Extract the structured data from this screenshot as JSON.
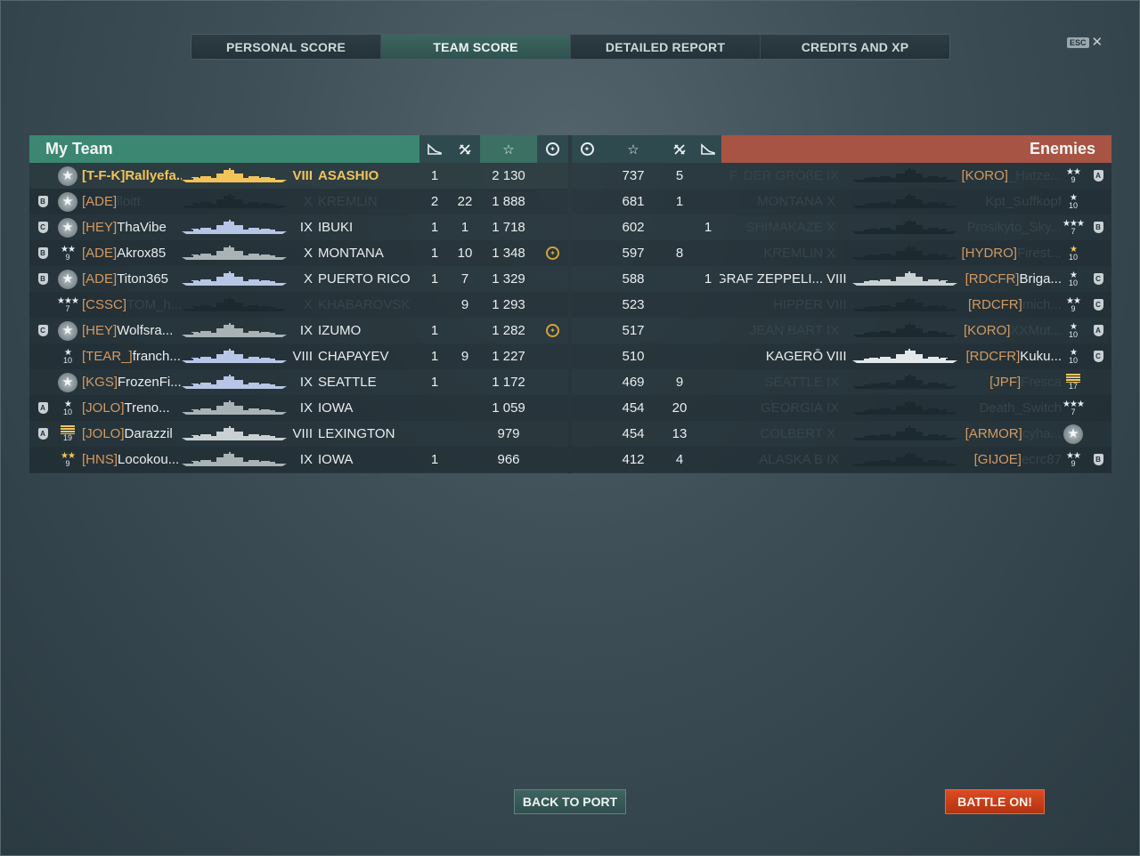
{
  "tabs": [
    {
      "label": "PERSONAL SCORE",
      "active": false
    },
    {
      "label": "TEAM SCORE",
      "active": true
    },
    {
      "label": "DETAILED REPORT",
      "active": false
    },
    {
      "label": "CREDITS AND XP",
      "active": false
    }
  ],
  "esc": {
    "key": "ESC",
    "close": "✕"
  },
  "my_team": {
    "title": "My Team",
    "columns": {
      "planes": "plane-icon",
      "frags": "frags-icon",
      "xp": "☆",
      "achievements": "crest-icon"
    },
    "rows": [
      {
        "division": "",
        "rank": {
          "type": "medal"
        },
        "clan": "[T-F-K]",
        "player": "Rallyefa...",
        "ship_color": "#f2c35a",
        "tier": "VIII",
        "ship": "ASASHIO",
        "planes": "1",
        "frags": "",
        "xp": "2 130",
        "ach": "",
        "me": true
      },
      {
        "division": "B",
        "rank": {
          "type": "medal"
        },
        "clan": "[ADE]",
        "player": "lloitt",
        "player_dim": true,
        "ship_color": "#1c2a30",
        "tier": "X",
        "ship": "KREMLIN",
        "ship_dim": true,
        "planes": "2",
        "frags": "22",
        "xp": "1 888",
        "ach": ""
      },
      {
        "division": "C",
        "rank": {
          "type": "medal"
        },
        "clan": "[HEY]",
        "player": "ThaVibe",
        "ship_color": "#b7c6e6",
        "tier": "IX",
        "ship": "IBUKI",
        "planes": "1",
        "frags": "1",
        "xp": "1 718",
        "ach": ""
      },
      {
        "division": "B",
        "rank": {
          "type": "stars",
          "stars": "★★",
          "num": "9"
        },
        "clan": "[ADE]",
        "player": "Akrox85",
        "ship_color": "#a9b3b6",
        "tier": "X",
        "ship": "MONTANA",
        "planes": "1",
        "frags": "10",
        "xp": "1 348",
        "ach": "crest"
      },
      {
        "division": "B",
        "rank": {
          "type": "medal"
        },
        "clan": "[ADE]",
        "player": "Titon365",
        "ship_color": "#b7c6e6",
        "tier": "X",
        "ship": "PUERTO RICO",
        "planes": "1",
        "frags": "7",
        "xp": "1 329",
        "ach": ""
      },
      {
        "division": "",
        "rank": {
          "type": "stars",
          "stars": "★★★",
          "num": "7"
        },
        "clan": "[CSSC]",
        "player": "TOM_h...",
        "player_dim": true,
        "ship_color": "#1c2a30",
        "tier": "X",
        "ship": "KHABAROVSK",
        "ship_dim": true,
        "planes": "",
        "frags": "9",
        "xp": "1 293",
        "ach": ""
      },
      {
        "division": "C",
        "rank": {
          "type": "medal"
        },
        "clan": "[HEY]",
        "player": "Wolfsra...",
        "ship_color": "#a9b3b6",
        "tier": "IX",
        "ship": "IZUMO",
        "planes": "1",
        "frags": "",
        "xp": "1 282",
        "ach": "crest"
      },
      {
        "division": "",
        "rank": {
          "type": "stars",
          "stars": "★",
          "num": "10"
        },
        "clan": "[TEAR_]",
        "player": "franch...",
        "ship_color": "#b7c6e6",
        "tier": "VIII",
        "ship": "CHAPAYEV",
        "planes": "1",
        "frags": "9",
        "xp": "1 227",
        "ach": ""
      },
      {
        "division": "",
        "rank": {
          "type": "medal"
        },
        "clan": "[KGS]",
        "player": "FrozenFi...",
        "ship_color": "#b7c6e6",
        "tier": "IX",
        "ship": "SEATTLE",
        "planes": "1",
        "frags": "",
        "xp": "1 172",
        "ach": ""
      },
      {
        "division": "A",
        "rank": {
          "type": "stars",
          "stars": "★",
          "num": "10"
        },
        "clan": "[JOLO]",
        "player": "Treno...",
        "ship_color": "#a9b3b6",
        "tier": "IX",
        "ship": "IOWA",
        "planes": "",
        "frags": "",
        "xp": "1 059",
        "ach": ""
      },
      {
        "division": "A",
        "rank": {
          "type": "bars",
          "num": "19"
        },
        "clan": "[JOLO]",
        "player": "Darazzil",
        "ship_color": "#c9d0d2",
        "tier": "VIII",
        "ship": "LEXINGTON",
        "planes": "",
        "frags": "",
        "xp": "979",
        "ach": ""
      },
      {
        "division": "",
        "rank": {
          "type": "stars",
          "stars": "★★",
          "num": "9",
          "gold": true
        },
        "clan": "[HNS]",
        "player": "Locokou...",
        "ship_color": "#a9b3b6",
        "tier": "IX",
        "ship": "IOWA",
        "planes": "1",
        "frags": "",
        "xp": "966",
        "ach": ""
      }
    ]
  },
  "enemies": {
    "title": "Enemies",
    "rows": [
      {
        "xp": "737",
        "frags": "5",
        "planes": "",
        "ship": "F. DER GROßE",
        "ship_dim": true,
        "tier": "IX",
        "tier_dim": true,
        "ship_color": "#1c2a30",
        "clan": "[KORO]",
        "player": "_Hatze...",
        "player_dim": true,
        "rank": {
          "type": "stars",
          "stars": "★★",
          "num": "9"
        },
        "division": "A"
      },
      {
        "xp": "681",
        "frags": "1",
        "planes": "",
        "ship": "MONTANA",
        "ship_dim": true,
        "tier": "X",
        "tier_dim": true,
        "ship_color": "#1c2a30",
        "clan": "",
        "player": "Kpt_Suffkopf",
        "player_dim": true,
        "rank": {
          "type": "stars",
          "stars": "★",
          "num": "10"
        },
        "division": ""
      },
      {
        "xp": "602",
        "frags": "",
        "planes": "1",
        "ship": "SHIMAKAZE",
        "ship_dim": true,
        "tier": "X",
        "tier_dim": true,
        "ship_color": "#1c2a30",
        "clan": "",
        "player": "Prosikyto_Sky...",
        "player_dim": true,
        "rank": {
          "type": "stars",
          "stars": "★★★",
          "num": "7"
        },
        "division": "B"
      },
      {
        "xp": "597",
        "frags": "8",
        "planes": "",
        "ship": "KREMLIN",
        "ship_dim": true,
        "tier": "X",
        "tier_dim": true,
        "ship_color": "#1c2a30",
        "clan": "[HYDRO]",
        "player": "Firest...",
        "player_dim": true,
        "rank": {
          "type": "stars",
          "stars": "★",
          "num": "10",
          "gold": true
        },
        "division": ""
      },
      {
        "xp": "588",
        "frags": "",
        "planes": "1",
        "ship": "GRAF ZEPPELI...",
        "tier": "VIII",
        "ship_color": "#c9d0d2",
        "clan": "[RDCFR]",
        "player": "Briga...",
        "rank": {
          "type": "stars",
          "stars": "★",
          "num": "10"
        },
        "division": "C"
      },
      {
        "xp": "523",
        "frags": "",
        "planes": "",
        "ship": "HIPPER",
        "ship_dim": true,
        "tier": "VIII",
        "tier_dim": true,
        "ship_color": "#1c2a30",
        "clan": "[RDCFR]",
        "player": "mich...",
        "player_dim": true,
        "rank": {
          "type": "stars",
          "stars": "★★",
          "num": "9"
        },
        "division": "C"
      },
      {
        "xp": "517",
        "frags": "",
        "planes": "",
        "ship": "JEAN BART",
        "ship_dim": true,
        "tier": "IX",
        "tier_dim": true,
        "ship_color": "#1c2a30",
        "clan": "[KORO]",
        "player": "XXMut...",
        "player_dim": true,
        "rank": {
          "type": "stars",
          "stars": "★",
          "num": "10"
        },
        "division": "A"
      },
      {
        "xp": "510",
        "frags": "",
        "planes": "",
        "ship": "KAGERŌ",
        "tier": "VIII",
        "ship_color": "#e3e8ea",
        "clan": "[RDCFR]",
        "player": "Kuku...",
        "rank": {
          "type": "stars",
          "stars": "★",
          "num": "10"
        },
        "division": "C"
      },
      {
        "xp": "469",
        "frags": "9",
        "planes": "",
        "ship": "SEATTLE",
        "ship_dim": true,
        "tier": "IX",
        "tier_dim": true,
        "ship_color": "#1c2a30",
        "clan": "[JPF]",
        "player": "Fresca",
        "player_dim": true,
        "rank": {
          "type": "bars",
          "num": "17"
        },
        "division": ""
      },
      {
        "xp": "454",
        "frags": "20",
        "planes": "",
        "ship": "GEORGIA",
        "ship_dim": true,
        "tier": "IX",
        "tier_dim": true,
        "ship_color": "#1c2a30",
        "clan": "",
        "player": "Death_Switch",
        "player_dim": true,
        "rank": {
          "type": "stars",
          "stars": "★★★",
          "num": "7"
        },
        "division": ""
      },
      {
        "xp": "454",
        "frags": "13",
        "planes": "",
        "ship": "COLBERT",
        "ship_dim": true,
        "tier": "X",
        "tier_dim": true,
        "ship_color": "#1c2a30",
        "clan": "[ARMOR]",
        "player": "cyha...",
        "player_dim": true,
        "rank": {
          "type": "medal"
        },
        "division": ""
      },
      {
        "xp": "412",
        "frags": "4",
        "planes": "",
        "ship": "ALASKA B",
        "ship_dim": true,
        "tier": "IX",
        "tier_dim": true,
        "ship_color": "#1c2a30",
        "clan": "[GIJOE]",
        "player": "ecrc87",
        "player_dim": true,
        "rank": {
          "type": "stars",
          "stars": "★★",
          "num": "9"
        },
        "division": "B"
      }
    ]
  },
  "buttons": {
    "back": "BACK TO PORT",
    "battle": "BATTLE ON!"
  },
  "colors": {
    "my_team": "#3b8772",
    "enemies": "#a85444",
    "highlight": "#f2c35a",
    "clan": "#d39a62"
  }
}
